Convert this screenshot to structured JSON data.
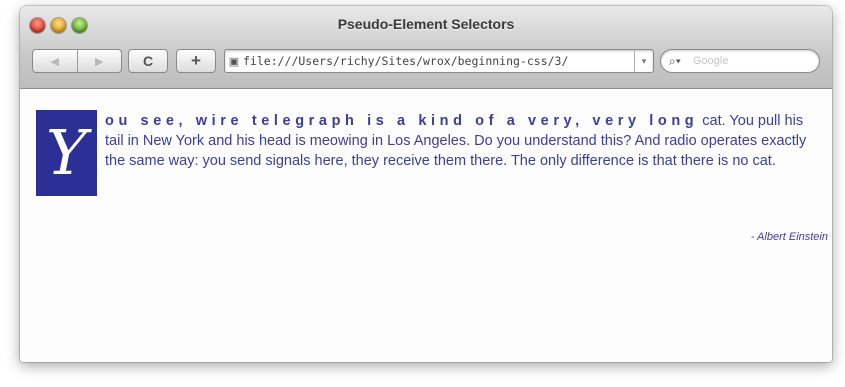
{
  "window": {
    "title": "Pseudo-Element Selectors"
  },
  "toolbar": {
    "back_icon": "back-arrow",
    "forward_icon": "forward-arrow",
    "reload_glyph": "C",
    "add_glyph": "+",
    "address": "file:///Users/richy/Sites/wrox/beginning-css/3/",
    "search_placeholder": "Google"
  },
  "content": {
    "drop_cap": "Y",
    "first_line": "ou see, wire telegraph is a kind of a very, very long",
    "rest_text": "cat. You pull his tail in New York and his head is meowing in Los Angeles. Do you understand this? And radio operates exactly the same way: you send signals here, they receive them there. The only difference is that there is no cat.",
    "attribution": "- Albert Einstein"
  },
  "colors": {
    "text": "#3a3f9a",
    "drop_cap_bg": "#2b2f96"
  }
}
